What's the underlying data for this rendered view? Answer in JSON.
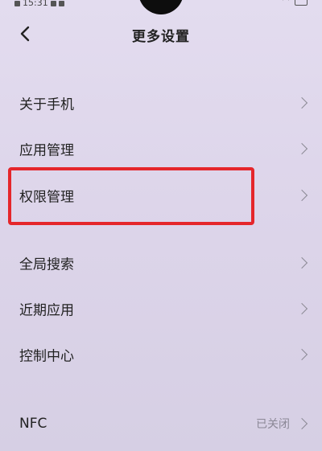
{
  "status_bar": {
    "time": "15:31"
  },
  "header": {
    "title": "更多设置"
  },
  "items": [
    {
      "label": "关于手机"
    },
    {
      "label": "应用管理"
    },
    {
      "label": "权限管理"
    },
    {
      "label": "全局搜索"
    },
    {
      "label": "近期应用"
    },
    {
      "label": "控制中心"
    },
    {
      "label": "NFC",
      "value": "已关闭"
    }
  ],
  "colors": {
    "background": "#ddd5ea",
    "highlight": "#e5262b",
    "chevron": "#8d8b96"
  }
}
